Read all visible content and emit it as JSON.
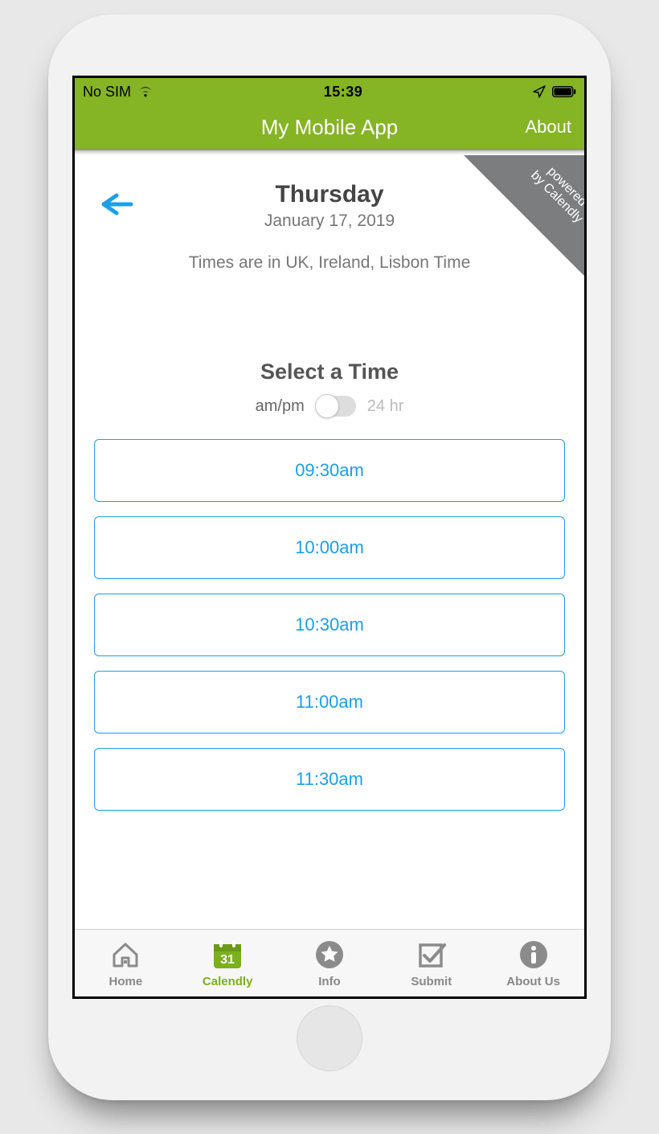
{
  "status": {
    "carrier": "No SIM",
    "time": "15:39"
  },
  "navbar": {
    "title": "My Mobile App",
    "about": "About"
  },
  "ribbon": {
    "line1": "powered",
    "line2": "by Calendly"
  },
  "head": {
    "day": "Thursday",
    "date": "January 17, 2019",
    "timezone": "Times are in UK, Ireland, Lisbon Time"
  },
  "select": {
    "title": "Select a Time",
    "ampm_label": "am/pm",
    "h24_label": "24 hr"
  },
  "slots": [
    "09:30am",
    "10:00am",
    "10:30am",
    "11:00am",
    "11:30am"
  ],
  "tabs": [
    {
      "label": "Home"
    },
    {
      "label": "Calendly"
    },
    {
      "label": "Info"
    },
    {
      "label": "Submit"
    },
    {
      "label": "About Us"
    }
  ]
}
